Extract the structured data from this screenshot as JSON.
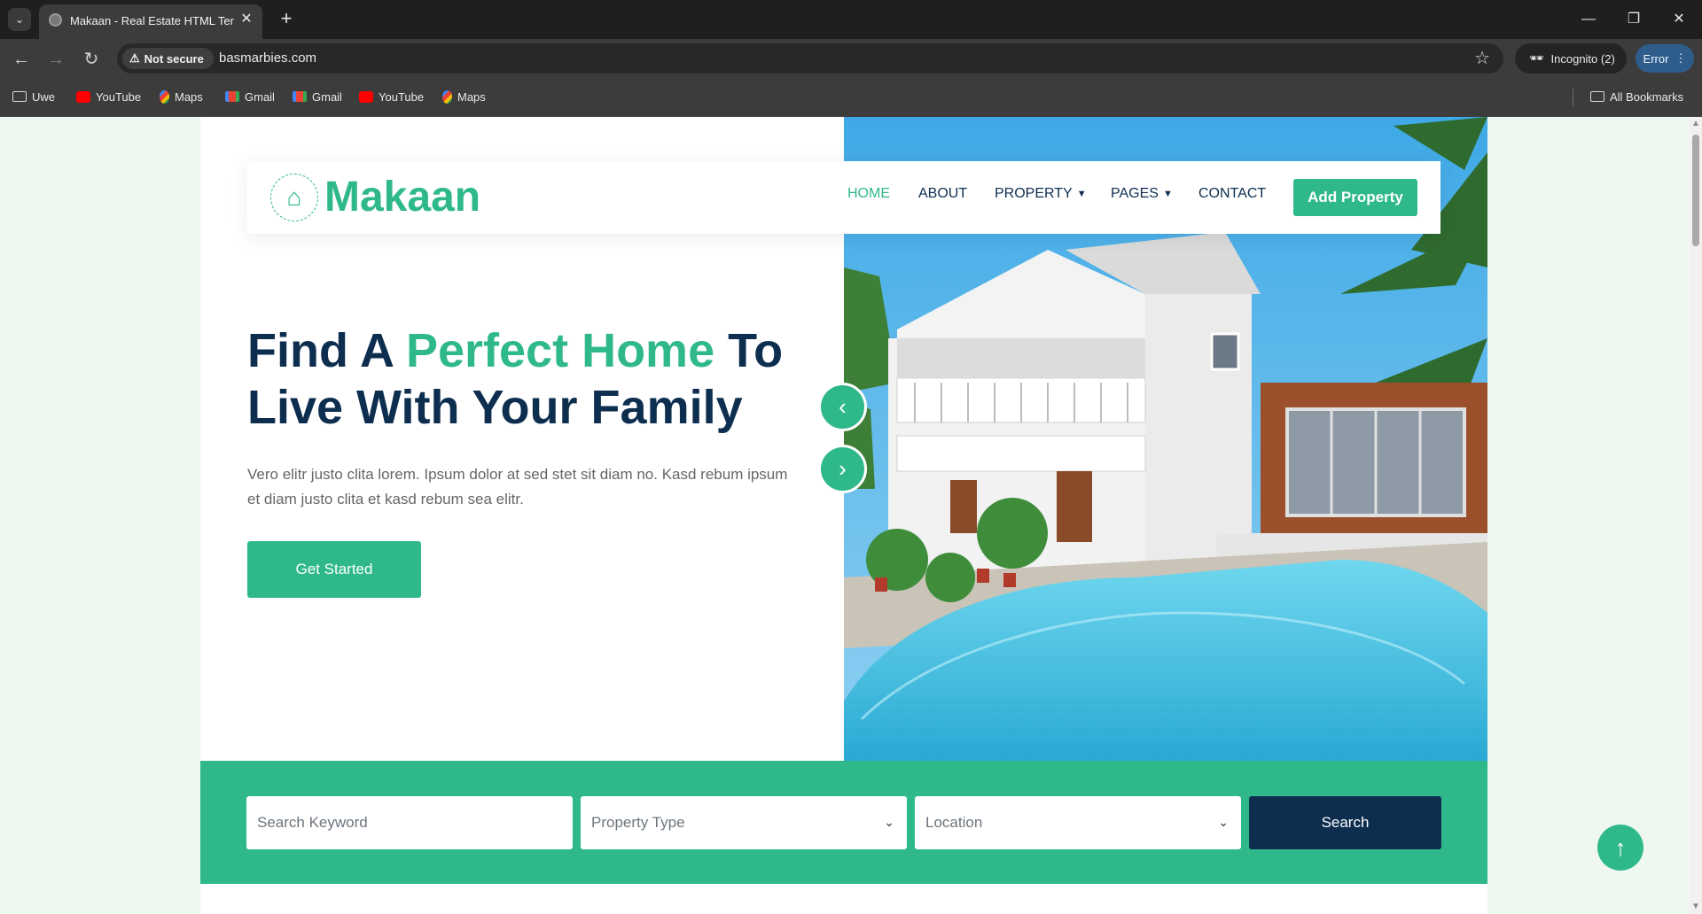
{
  "browser": {
    "tab_title": "Makaan - Real Estate HTML Template",
    "new_tab_symbol": "+",
    "security_label": "Not secure",
    "url": "basmarbies.com",
    "incognito_label": "Incognito (2)",
    "error_label": "Error",
    "bookmarks": [
      {
        "label": "Uwe",
        "icon": "folder-icon"
      },
      {
        "label": "YouTube",
        "icon": "youtube-icon"
      },
      {
        "label": "Maps",
        "icon": "maps-icon"
      },
      {
        "label": "Gmail",
        "icon": "gmail-icon"
      },
      {
        "label": "Gmail",
        "icon": "gmail-icon"
      },
      {
        "label": "YouTube",
        "icon": "youtube-icon"
      },
      {
        "label": "Maps",
        "icon": "maps-icon"
      }
    ],
    "all_bookmarks_label": "All Bookmarks"
  },
  "site": {
    "logo_text": "Makaan",
    "nav": [
      {
        "label": "HOME",
        "active": true
      },
      {
        "label": "ABOUT",
        "active": false
      },
      {
        "label": "PROPERTY",
        "active": false,
        "dropdown": true
      },
      {
        "label": "PAGES",
        "active": false,
        "dropdown": true
      },
      {
        "label": "CONTACT",
        "active": false
      }
    ],
    "add_property_label": "Add Property",
    "hero": {
      "title_part1": "Find A ",
      "title_accent": "Perfect Home",
      "title_part2": " To Live With Your Family",
      "text": "Vero elitr justo clita lorem. Ipsum dolor at sed stet sit diam no. Kasd rebum ipsum et diam justo clita et kasd rebum sea elitr.",
      "cta_label": "Get Started"
    },
    "search": {
      "keyword_placeholder": "Search Keyword",
      "property_type_value": "Property Type",
      "location_value": "Location",
      "button_label": "Search"
    },
    "colors": {
      "primary": "#2fb98b",
      "dark": "#0e2e50",
      "background": "#eff7f1"
    }
  }
}
